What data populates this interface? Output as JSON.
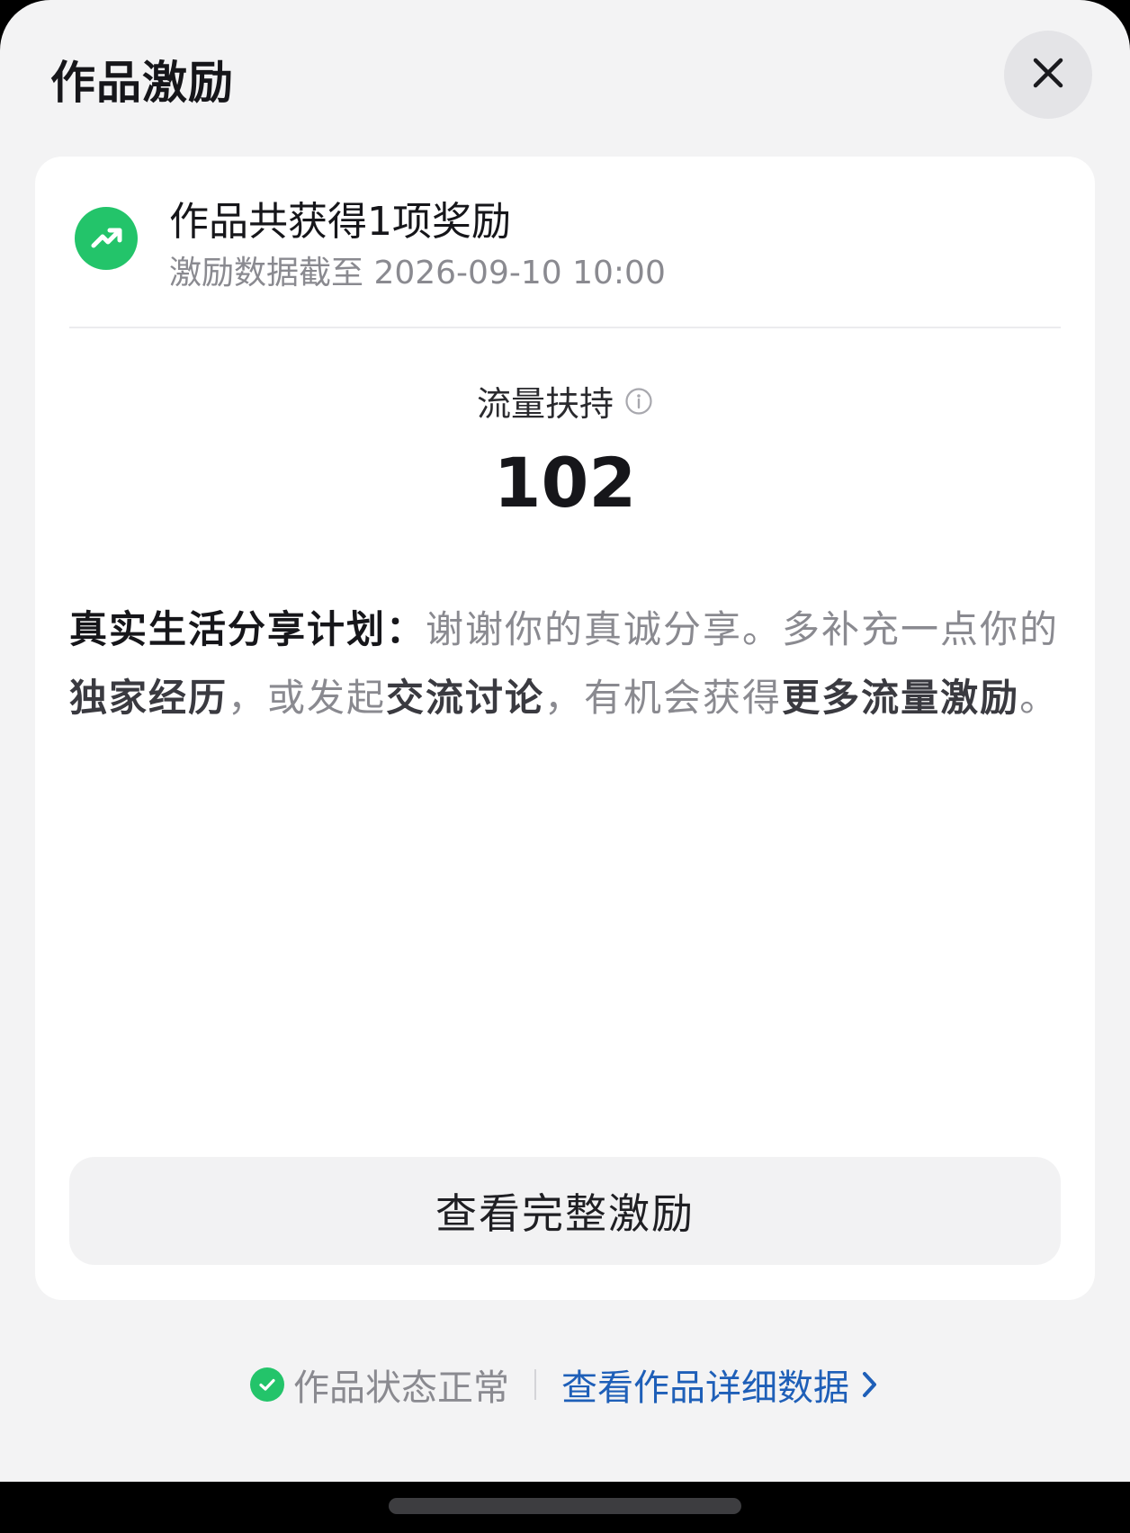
{
  "sheet": {
    "title": "作品激励"
  },
  "card": {
    "award_title": "作品共获得1项奖励",
    "award_subtitle": "激励数据截至 2026-09-10 10:00",
    "metric": {
      "label": "流量扶持",
      "value": "102"
    },
    "description": {
      "lead": "真实生活分享计划：",
      "part1": "谢谢你的真诚分享。多补充一点你的",
      "bold1": "独家经历",
      "part2": "，或发起",
      "bold2": "交流讨论",
      "part3": "，有机会获得",
      "bold3": "更多流量激励",
      "part4": "。"
    },
    "full_button_label": "查看完整激励"
  },
  "footer": {
    "status_text": "作品状态正常",
    "detail_link_label": "查看作品详细数据"
  },
  "colors": {
    "accent_green": "#23c46a",
    "link_blue": "#1e5fb8"
  },
  "icons": [
    "close-icon",
    "trending-up-icon",
    "info-icon",
    "check-circle-icon",
    "chevron-right-icon"
  ]
}
